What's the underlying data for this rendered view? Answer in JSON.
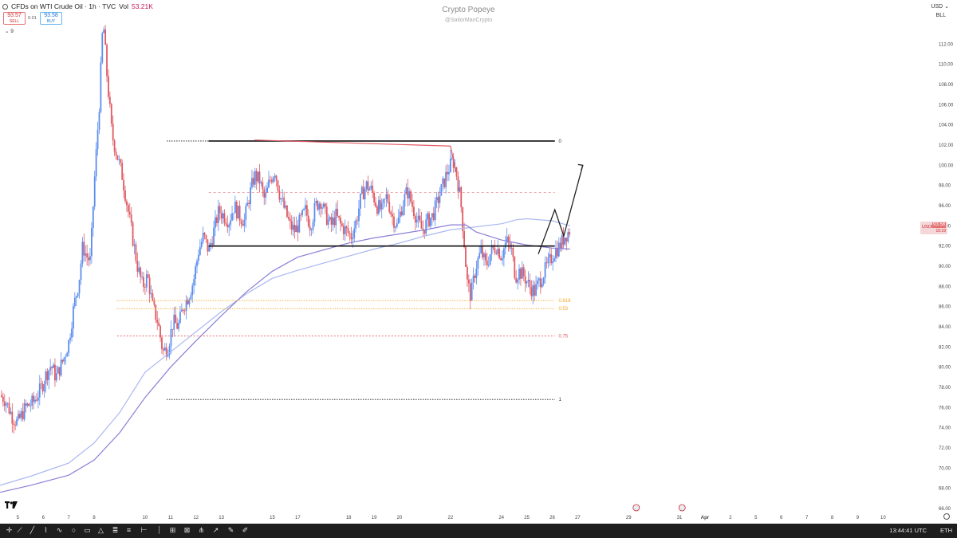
{
  "header": {
    "symbol_title": "CFDs on WTI Crude Oil · 1h · TVC",
    "volume_label": "Vol",
    "volume_value": "53.21K",
    "sell_price": "93.57",
    "sell_label": "SELL",
    "buy_price": "93.58",
    "buy_label": "BUY",
    "spread": "0.01",
    "indicator_count": "9"
  },
  "watermark": {
    "title": "Crypto Popeye",
    "subtitle": "@SailorManCrypto"
  },
  "scale": {
    "currency": "USD",
    "unit": "BLL"
  },
  "toolbar": {
    "clock": "13:44:41 UTC",
    "timezone": "ETH"
  },
  "price_badge": {
    "symbol": "USOIL",
    "value": "93.58",
    "countdown": "15:19"
  },
  "colors": {
    "up_candle": "#5b8def",
    "down_candle": "#e05a63",
    "ma_fast": "#a9b8f0",
    "ma_slow": "#8a7fd6",
    "fib_orange": "#f5a623",
    "fib_red": "#e05a63",
    "trendline_red": "#e05a63",
    "level_black": "#111111"
  },
  "chart_data": {
    "type": "candlestick",
    "title": "CFDs on WTI Crude Oil · 1h · TVC",
    "ylim": [
      66,
      114
    ],
    "ytick_values": [
      66,
      68,
      70,
      72,
      74,
      76,
      78,
      80,
      82,
      84,
      86,
      88,
      90,
      92,
      94,
      96,
      98,
      100,
      102,
      104,
      106,
      108,
      110,
      112
    ],
    "ytick_labels": [
      "66.00",
      "68.00",
      "70.00",
      "72.00",
      "74.00",
      "76.00",
      "78.00",
      "80.00",
      "82.00",
      "84.00",
      "86.00",
      "88.00",
      "90.00",
      "92.00",
      "94.00",
      "96.00",
      "98.00",
      "100.00",
      "102.00",
      "104.00",
      "106.00",
      "108.00",
      "110.00",
      "112.00"
    ],
    "xlim": [
      4.3,
      40.9
    ],
    "xtick_values": [
      5,
      6,
      7,
      8,
      10,
      11,
      12,
      13,
      15,
      16,
      18,
      19,
      20,
      22,
      24,
      25,
      26,
      27,
      29,
      31,
      32,
      33,
      34,
      35,
      36,
      37,
      38,
      39,
      40
    ],
    "xtick_labels": [
      "5",
      "6",
      "7",
      "8",
      "10",
      "11",
      "12",
      "13",
      "15",
      "17",
      "18",
      "19",
      "20",
      "22",
      "24",
      "25",
      "26",
      "27",
      "29",
      "31",
      "Apr",
      "2",
      "5",
      "6",
      "7",
      "8",
      "9",
      "10"
    ],
    "price_path": [
      [
        4.3,
        77.2
      ],
      [
        4.5,
        76.8
      ],
      [
        4.8,
        75.0
      ],
      [
        5.0,
        74.5
      ],
      [
        5.3,
        76.0
      ],
      [
        5.6,
        76.5
      ],
      [
        5.9,
        77.8
      ],
      [
        6.1,
        79.2
      ],
      [
        6.3,
        80.2
      ],
      [
        6.5,
        79.0
      ],
      [
        6.8,
        80.8
      ],
      [
        7.0,
        82.5
      ],
      [
        7.2,
        86.0
      ],
      [
        7.4,
        88.5
      ],
      [
        7.55,
        92.0
      ],
      [
        7.7,
        91.0
      ],
      [
        7.85,
        90.5
      ],
      [
        8.0,
        98.0
      ],
      [
        8.2,
        106.0
      ],
      [
        8.35,
        114.5
      ],
      [
        8.5,
        109.0
      ],
      [
        8.7,
        103.0
      ],
      [
        8.9,
        101.0
      ],
      [
        9.1,
        99.0
      ],
      [
        9.3,
        96.0
      ],
      [
        9.5,
        93.0
      ],
      [
        9.7,
        90.0
      ],
      [
        9.9,
        88.0
      ],
      [
        10.1,
        89.0
      ],
      [
        10.3,
        86.0
      ],
      [
        10.5,
        84.5
      ],
      [
        10.7,
        81.5
      ],
      [
        10.9,
        82.0
      ],
      [
        11.1,
        84.5
      ],
      [
        11.3,
        84.0
      ],
      [
        11.5,
        86.0
      ],
      [
        11.7,
        87.0
      ],
      [
        11.9,
        88.5
      ],
      [
        12.1,
        91.5
      ],
      [
        12.3,
        93.0
      ],
      [
        12.5,
        91.5
      ],
      [
        12.7,
        93.5
      ],
      [
        12.9,
        95.5
      ],
      [
        13.1,
        95.0
      ],
      [
        13.3,
        94.5
      ],
      [
        13.5,
        96.0
      ],
      [
        13.7,
        95.0
      ],
      [
        13.9,
        94.5
      ],
      [
        14.1,
        97.0
      ],
      [
        14.3,
        99.0
      ],
      [
        14.5,
        98.5
      ],
      [
        14.7,
        96.5
      ],
      [
        14.9,
        98.5
      ],
      [
        15.1,
        99.5
      ],
      [
        15.3,
        97.0
      ],
      [
        15.5,
        95.5
      ],
      [
        15.7,
        94.0
      ],
      [
        15.9,
        93.5
      ],
      [
        16.1,
        94.5
      ],
      [
        16.3,
        95.5
      ],
      [
        16.5,
        94.0
      ],
      [
        16.7,
        96.0
      ],
      [
        16.9,
        96.5
      ],
      [
        17.1,
        95.0
      ],
      [
        17.3,
        94.0
      ],
      [
        17.5,
        95.0
      ],
      [
        17.7,
        94.0
      ],
      [
        17.9,
        93.5
      ],
      [
        18.1,
        93.0
      ],
      [
        18.3,
        94.5
      ],
      [
        18.5,
        97.0
      ],
      [
        18.7,
        98.0
      ],
      [
        18.9,
        97.5
      ],
      [
        19.1,
        96.0
      ],
      [
        19.3,
        95.5
      ],
      [
        19.5,
        97.0
      ],
      [
        19.7,
        95.0
      ],
      [
        19.9,
        94.0
      ],
      [
        20.1,
        96.0
      ],
      [
        20.3,
        97.5
      ],
      [
        20.5,
        96.0
      ],
      [
        20.7,
        94.5
      ],
      [
        20.9,
        93.5
      ],
      [
        21.1,
        94.5
      ],
      [
        21.3,
        95.0
      ],
      [
        21.5,
        96.5
      ],
      [
        21.7,
        98.0
      ],
      [
        21.9,
        99.5
      ],
      [
        22.1,
        100.5
      ],
      [
        22.25,
        99.0
      ],
      [
        22.4,
        96.5
      ],
      [
        22.55,
        92.0
      ],
      [
        22.65,
        88.5
      ],
      [
        22.8,
        87.0
      ],
      [
        23.0,
        90.0
      ],
      [
        23.2,
        91.5
      ],
      [
        23.4,
        90.0
      ],
      [
        23.6,
        91.5
      ],
      [
        23.8,
        92.0
      ],
      [
        24.0,
        91.0
      ],
      [
        24.2,
        92.5
      ],
      [
        24.4,
        91.5
      ],
      [
        24.55,
        89.0
      ],
      [
        24.7,
        89.5
      ],
      [
        24.9,
        89.0
      ],
      [
        25.1,
        88.0
      ],
      [
        25.3,
        87.5
      ],
      [
        25.5,
        88.5
      ],
      [
        25.7,
        89.5
      ],
      [
        25.9,
        90.5
      ],
      [
        26.1,
        91.5
      ],
      [
        26.3,
        92.0
      ],
      [
        26.5,
        93.0
      ],
      [
        26.7,
        93.6
      ]
    ],
    "series": [
      {
        "name": "",
        "type": "line",
        "points": [
          [
            4.3,
            68.3
          ],
          [
            5.5,
            69.2
          ],
          [
            7.0,
            70.5
          ],
          [
            8.0,
            72.5
          ],
          [
            9.0,
            75.5
          ],
          [
            10.0,
            79.5
          ],
          [
            11.0,
            81.5
          ],
          [
            12.0,
            83.5
          ],
          [
            13.0,
            85.5
          ],
          [
            14.0,
            87.3
          ],
          [
            15.0,
            88.8
          ],
          [
            16.0,
            89.6
          ],
          [
            17.0,
            90.3
          ],
          [
            18.0,
            91.0
          ],
          [
            19.0,
            91.7
          ],
          [
            20.0,
            92.3
          ],
          [
            21.0,
            93.0
          ],
          [
            22.0,
            93.6
          ],
          [
            23.0,
            93.9
          ],
          [
            24.0,
            94.2
          ],
          [
            24.6,
            94.6
          ],
          [
            25.0,
            94.7
          ],
          [
            26.0,
            94.5
          ],
          [
            26.7,
            94.0
          ]
        ]
      },
      {
        "name": "",
        "type": "line",
        "points": [
          [
            4.3,
            67.6
          ],
          [
            5.5,
            68.3
          ],
          [
            7.0,
            69.3
          ],
          [
            8.0,
            70.8
          ],
          [
            9.0,
            73.5
          ],
          [
            10.0,
            77.0
          ],
          [
            11.0,
            80.0
          ],
          [
            12.0,
            82.6
          ],
          [
            13.0,
            85.1
          ],
          [
            14.0,
            87.5
          ],
          [
            15.0,
            89.5
          ],
          [
            16.0,
            90.9
          ],
          [
            17.0,
            91.6
          ],
          [
            18.0,
            92.3
          ],
          [
            19.0,
            92.8
          ],
          [
            20.0,
            93.2
          ],
          [
            21.0,
            93.6
          ],
          [
            22.0,
            94.1
          ],
          [
            22.6,
            94.1
          ],
          [
            23.0,
            93.4
          ],
          [
            24.0,
            92.6
          ],
          [
            25.0,
            92.1
          ],
          [
            26.0,
            91.8
          ],
          [
            26.7,
            91.7
          ]
        ]
      }
    ],
    "fib_levels": [
      {
        "label": "0",
        "value": 102.4
      },
      {
        "label": "0.618",
        "value": 86.6
      },
      {
        "label": "0.53",
        "value": 85.8
      },
      {
        "label": "0.75",
        "value": 83.1
      },
      {
        "label": "1",
        "value": 76.8
      }
    ],
    "dashed_level": 97.3,
    "support_level": 92.0,
    "resistance_level": 102.4,
    "last_price": 93.58
  }
}
